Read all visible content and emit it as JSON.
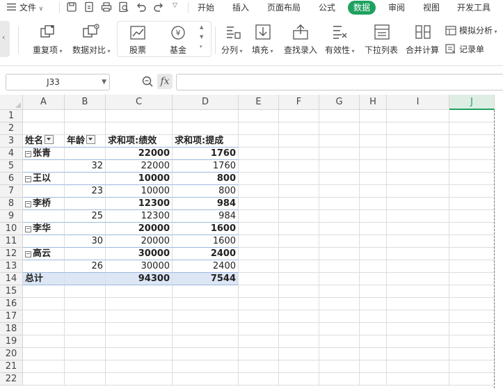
{
  "menu": {
    "file_label": "文件",
    "tabs": [
      {
        "label": "开始",
        "active": false
      },
      {
        "label": "插入",
        "active": false
      },
      {
        "label": "页面布局",
        "active": false
      },
      {
        "label": "公式",
        "active": false
      },
      {
        "label": "数据",
        "active": true
      },
      {
        "label": "审阅",
        "active": false
      },
      {
        "label": "视图",
        "active": false
      },
      {
        "label": "开发工具",
        "active": false
      }
    ]
  },
  "ribbon": {
    "duplicate_label": "重复项",
    "compare_label": "数据对比",
    "stock_label": "股票",
    "fund_label": "基金",
    "split_label": "分列",
    "fill_label": "填充",
    "lookup_label": "查找录入",
    "validity_label": "有效性",
    "dropdown_label": "下拉列表",
    "consolidate_label": "合并计算",
    "simulate_label": "模拟分析",
    "record_label": "记录单"
  },
  "formula_bar": {
    "name_box": "J33",
    "fx_label": "fx"
  },
  "columns": [
    "A",
    "B",
    "C",
    "D",
    "E",
    "F",
    "G",
    "H",
    "I",
    "J"
  ],
  "selected_column": "J",
  "rows": [
    "1",
    "2",
    "3",
    "4",
    "5",
    "6",
    "7",
    "8",
    "9",
    "10",
    "11",
    "12",
    "13",
    "14",
    "15",
    "16",
    "17",
    "18",
    "19",
    "20",
    "21",
    "22"
  ],
  "pivot": {
    "headers": [
      "姓名",
      "年龄",
      "求和项:绩效",
      "求和项:提成"
    ],
    "groups": [
      {
        "name": "张青",
        "sum_perf": "22000",
        "sum_comm": "1760",
        "age": "32",
        "perf": "22000",
        "comm": "1760"
      },
      {
        "name": "王以",
        "sum_perf": "10000",
        "sum_comm": "800",
        "age": "23",
        "perf": "10000",
        "comm": "800"
      },
      {
        "name": "李桥",
        "sum_perf": "12300",
        "sum_comm": "984",
        "age": "25",
        "perf": "12300",
        "comm": "984"
      },
      {
        "name": "李华",
        "sum_perf": "20000",
        "sum_comm": "1600",
        "age": "30",
        "perf": "20000",
        "comm": "1600"
      },
      {
        "name": "高云",
        "sum_perf": "30000",
        "sum_comm": "2400",
        "age": "26",
        "perf": "30000",
        "comm": "2400"
      }
    ],
    "total_label": "总计",
    "total_perf": "94300",
    "total_comm": "7544"
  },
  "colors": {
    "accent": "#1fa160",
    "pivot_total_bg": "#dce6f4"
  }
}
